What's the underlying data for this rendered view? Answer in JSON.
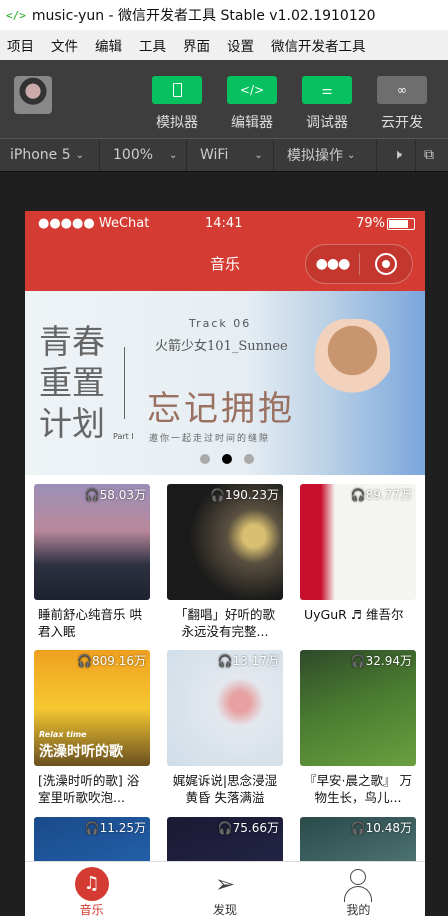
{
  "window": {
    "title": "music-yun - 微信开发者工具 Stable v1.02.1910120",
    "logo": "</>"
  },
  "menu": [
    "项目",
    "文件",
    "编辑",
    "工具",
    "界面",
    "设置",
    "微信开发者工具"
  ],
  "toolbar": {
    "buttons": [
      {
        "label": "模拟器",
        "icon": "phone-icon"
      },
      {
        "label": "编辑器",
        "icon": "code-icon"
      },
      {
        "label": "调试器",
        "icon": "sliders-icon"
      },
      {
        "label": "云开发",
        "icon": "cloud-link-icon"
      }
    ]
  },
  "device": {
    "model": "iPhone 5",
    "zoom": "100%",
    "network": "WiFi",
    "operation": "模拟操作"
  },
  "phone": {
    "status": {
      "carrier": "●●●●● WeChat",
      "time": "14:41",
      "battery": "79%",
      "battery_level": 0.79
    },
    "nav_title": "音乐",
    "banner": {
      "heading": "青春重置计划",
      "track": "Track 06",
      "artist": "火箭少女101_Sunnee",
      "song": "忘记拥抱",
      "part": "Part I",
      "tagline": "邀你一起走过时间的缝隙",
      "dots": 3,
      "active_dot": 2
    },
    "playlists": [
      {
        "count": "58.03万",
        "title": "睡前舒心纯音乐 哄君入眠"
      },
      {
        "count": "190.23万",
        "title": "「翻唱」好听的歌永远没有完整..."
      },
      {
        "count": "89.77万",
        "title": "UyGuR ♬ 维吾尔"
      },
      {
        "count": "809.16万",
        "title": "[洗澡时听的歌] 浴室里听歌吹泡...",
        "cover_text": "Relax time",
        "cover_title": "洗澡时听的歌"
      },
      {
        "count": "13.17万",
        "title": "娓娓诉说|思念浸湿黄昏 失落满溢"
      },
      {
        "count": "32.94万",
        "title": "『早安·晨之歌』 万物生长，鸟儿..."
      },
      {
        "count": "11.25万",
        "title": ""
      },
      {
        "count": "75.66万",
        "title": ""
      },
      {
        "count": "10.48万",
        "title": ""
      }
    ],
    "tabs": [
      {
        "label": "音乐",
        "active": true
      },
      {
        "label": "发现"
      },
      {
        "label": "我的"
      }
    ]
  },
  "colors": {
    "brand": "#d43c33",
    "green": "#07c160"
  }
}
